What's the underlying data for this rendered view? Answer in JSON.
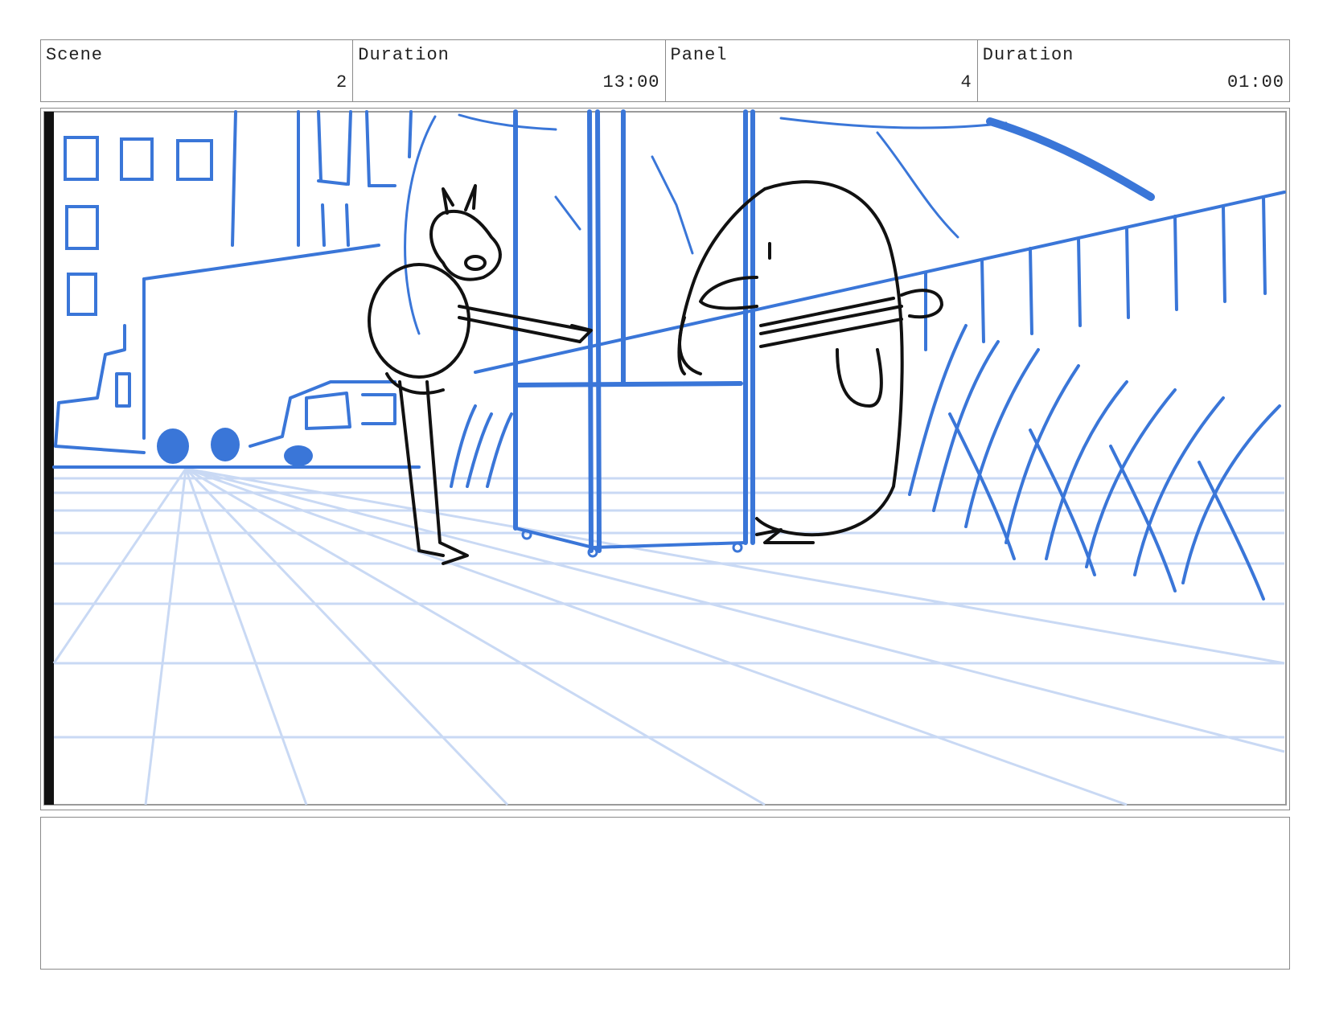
{
  "header": {
    "scene_label": "Scene",
    "scene_value": "2",
    "scene_duration_label": "Duration",
    "scene_duration_value": "13:00",
    "panel_label": "Panel",
    "panel_value": "4",
    "panel_duration_label": "Duration",
    "panel_duration_value": "01:00"
  },
  "panel": {
    "image_icon": "storyboard-sketch",
    "colors": {
      "background": "#3a76d8",
      "grid": "#c9d9f4",
      "ink": "#111111"
    }
  },
  "notes": {
    "text": ""
  }
}
